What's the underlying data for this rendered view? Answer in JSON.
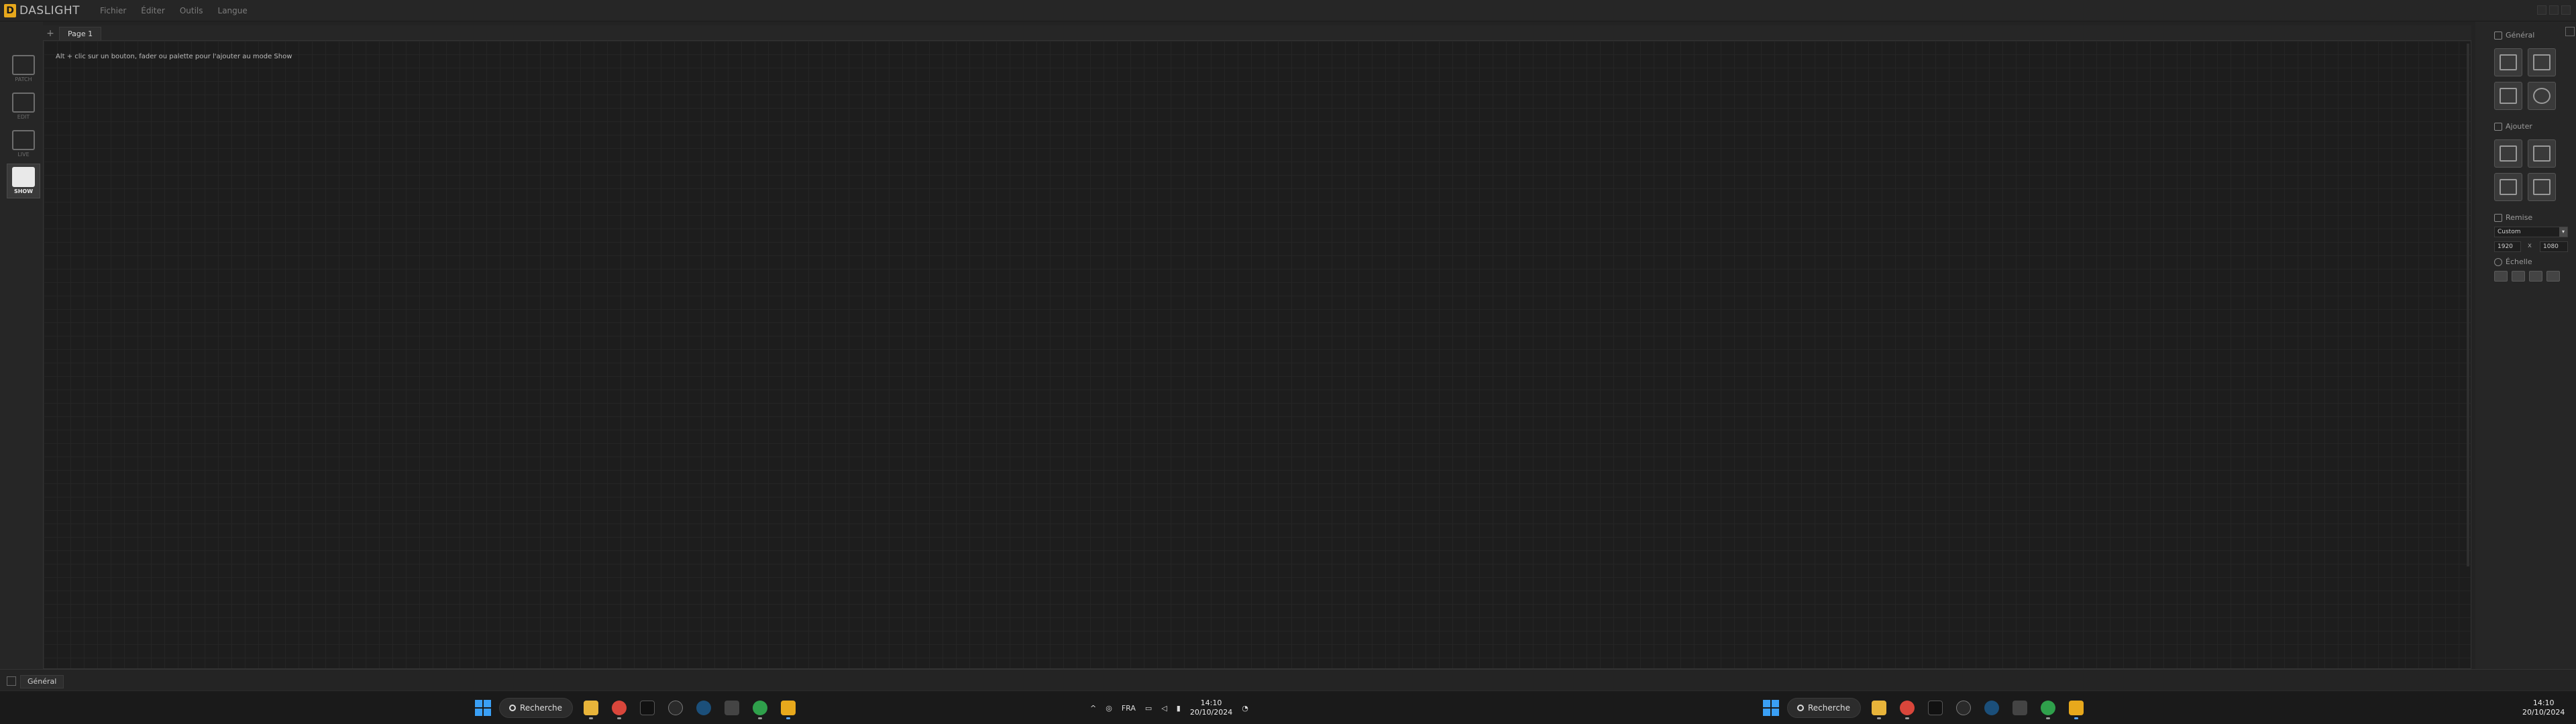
{
  "app": {
    "logo_mark": "D",
    "name": "DASLIGHT",
    "menu": [
      "Fichier",
      "Éditer",
      "Outils",
      "Langue"
    ]
  },
  "modes": [
    {
      "key": "patch",
      "label": "PATCH",
      "active": false
    },
    {
      "key": "edit",
      "label": "EDIT",
      "active": false
    },
    {
      "key": "live",
      "label": "LIVE",
      "active": false
    },
    {
      "key": "show",
      "label": "SHOW",
      "active": true
    }
  ],
  "tabs": {
    "add_symbol": "+",
    "pages": [
      "Page 1"
    ]
  },
  "canvas": {
    "hint": "Alt + clic sur un bouton, fader ou palette pour l'ajouter au mode Show"
  },
  "panel": {
    "general_title": "Général",
    "add_title": "Ajouter",
    "resize_title": "Remise",
    "preset_value": "Custom",
    "preset_arrow": "▾",
    "width_value": "1920",
    "x_separator": "x",
    "height_value": "1080",
    "zoom_title": "Échelle"
  },
  "bottom": {
    "tab_label": "Général"
  },
  "taskbar": {
    "search_label": "Recherche",
    "language": "FRA",
    "time": "14:10",
    "date": "20/10/2024"
  },
  "colors": {
    "accent": "#e7a81c",
    "windows_blue": "#3a9ff5"
  }
}
